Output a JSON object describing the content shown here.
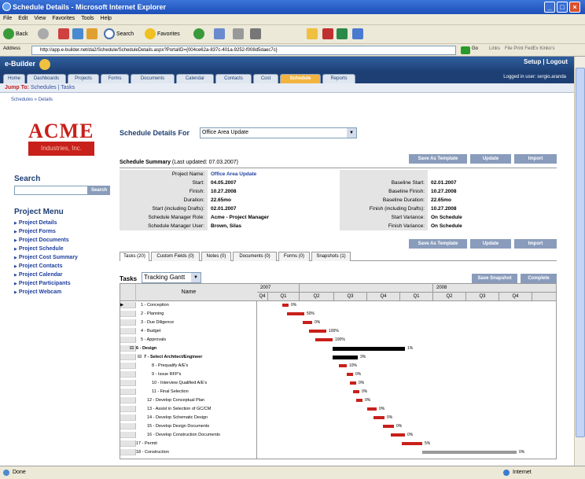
{
  "window": {
    "title": "Schedule Details - Microsoft Internet Explorer"
  },
  "menu": [
    "File",
    "Edit",
    "View",
    "Favorites",
    "Tools",
    "Help"
  ],
  "toolbar": {
    "back": "Back",
    "search": "Search",
    "favorites": "Favorites"
  },
  "address": {
    "label": "Address",
    "url": "http://app.e-builder.net/da2/Schedule/ScheduleDetails.aspx?PortalID={004ce62a-837c-401a-9252-f008d5daec7c}",
    "go": "Go",
    "links": "Links",
    "extra": "File Print FedEx Kinko's"
  },
  "site": {
    "logo": "e-Builder",
    "setup_logout": "Setup | Logout",
    "tabs": [
      "Home",
      "Dashboards",
      "Projects",
      "Forms",
      "Documents",
      "Calendar",
      "Contacts",
      "Cost",
      "Schedule",
      "Reports"
    ],
    "active_tab": "Schedule",
    "logged_in": "Logged in user: sergio.aranda",
    "jump_label": "Jump To:",
    "jump_links": "Schedules | Tasks",
    "breadcrumb": "Schedules » Details"
  },
  "left": {
    "logo_top": "ACME",
    "logo_bottom": "Industries, Inc.",
    "search_title": "Search",
    "search_button": "Search",
    "menu_title": "Project Menu",
    "menu_items": [
      "Project Details",
      "Project Forms",
      "Project Documents",
      "Project Schedule",
      "Project Cost Summary",
      "Project Contacts",
      "Project Calendar",
      "Project Participants",
      "Project Webcam"
    ]
  },
  "main": {
    "title": "Schedule Details For",
    "selected_schedule": "Office Area Update",
    "buttons": [
      "Save As Template",
      "Update",
      "Import"
    ],
    "summary_title": "Schedule Summary",
    "summary_updated": "(Last updated: 07.03.2007)",
    "summary_rows": [
      {
        "l": "Project Name:",
        "lv": "Office Area Update",
        "r": "",
        "rv": ""
      },
      {
        "l": "Start:",
        "lv": "04.05.2007",
        "r": "Baseline Start:",
        "rv": "02.01.2007"
      },
      {
        "l": "Finish:",
        "lv": "10.27.2008",
        "r": "Baseline Finish:",
        "rv": "10.27.2008"
      },
      {
        "l": "Duration:",
        "lv": "22.65mo",
        "r": "Baseline Duration:",
        "rv": "22.65mo"
      },
      {
        "l": "Start (including Drafts):",
        "lv": "02.01.2007",
        "r": "Finish (including Drafts):",
        "rv": "10.27.2008"
      },
      {
        "l": "Schedule Manager Role:",
        "lv": "Acme - Project Manager",
        "r": "Start Variance:",
        "rv": "On Schedule"
      },
      {
        "l": "Schedule Manager User:",
        "lv": "Brown, Silas",
        "r": "Finish Variance:",
        "rv": "On Schedule"
      }
    ],
    "subtabs": [
      "Tasks (20)",
      "Custom Fields (0)",
      "Notes (0)",
      "Documents (0)",
      "Forms (0)",
      "Snapshots (1)"
    ],
    "tasks_label": "Tasks",
    "tasks_view": "Tracking Gantt",
    "task_buttons": [
      "Save Snapshot",
      "Complete"
    ],
    "gantt_name_header": "Name",
    "years": [
      "2007",
      "2008"
    ],
    "quarters": [
      "Q4",
      "Q1",
      "Q2",
      "Q3",
      "Q4",
      "Q1",
      "Q2",
      "Q3",
      "Q4"
    ],
    "tasks": [
      {
        "name": "1 - Conception",
        "pct": "0%"
      },
      {
        "name": "2 - Planning",
        "pct": "50%"
      },
      {
        "name": "3 - Due Diligence",
        "pct": "0%"
      },
      {
        "name": "4 - Budget",
        "pct": "100%"
      },
      {
        "name": "5 - Approvals",
        "pct": "100%"
      },
      {
        "name": "6 - Design",
        "pct": "1%"
      },
      {
        "name": "7 - Select Architect/Engineer",
        "pct": "3%"
      },
      {
        "name": "8 - Prequalify A/E's",
        "pct": "10%"
      },
      {
        "name": "9 - Issue RFP's",
        "pct": "0%"
      },
      {
        "name": "10 - Interview Qualified A/E's",
        "pct": "0%"
      },
      {
        "name": "11 - Final Selection",
        "pct": "0%"
      },
      {
        "name": "12 - Develop Conceptual Plan",
        "pct": "0%"
      },
      {
        "name": "13 - Assist in Selection of GC/CM",
        "pct": "0%"
      },
      {
        "name": "14 - Develop Schematic Design",
        "pct": "0%"
      },
      {
        "name": "15 - Develop Design Documents",
        "pct": "0%"
      },
      {
        "name": "16 - Develop Construction Documents",
        "pct": "0%"
      },
      {
        "name": "17 - Permit",
        "pct": "5%"
      },
      {
        "name": "18 - Construction",
        "pct": "0%"
      }
    ]
  },
  "status": {
    "left": "Done",
    "right": "Internet"
  },
  "colors": {
    "titlebar": "#1d4fb8",
    "header": "#1d3f74",
    "active_tab": "#f2b340",
    "brand_red": "#c8201a",
    "bar_red": "#c8201a",
    "bar_black": "#000000"
  }
}
